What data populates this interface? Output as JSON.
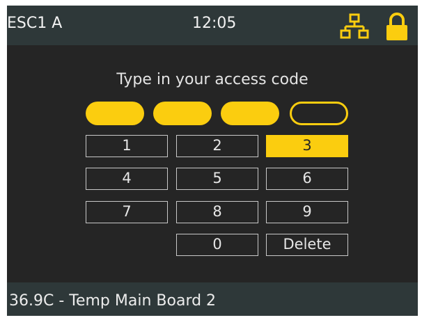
{
  "header": {
    "device": "ESC1 A",
    "time": "12:05",
    "network_icon": "network-icon",
    "lock_icon": "lock-icon"
  },
  "prompt": "Type in your access code",
  "code": {
    "length": 4,
    "entered": 3
  },
  "keypad": {
    "keys": [
      "1",
      "2",
      "3",
      "4",
      "5",
      "6",
      "7",
      "8",
      "9",
      "0",
      "Delete"
    ],
    "active_key": "3"
  },
  "status": "36.9C - Temp Main Board 2",
  "colors": {
    "accent": "#fbcd0f",
    "background": "#252525",
    "bar": "#2e3839"
  }
}
